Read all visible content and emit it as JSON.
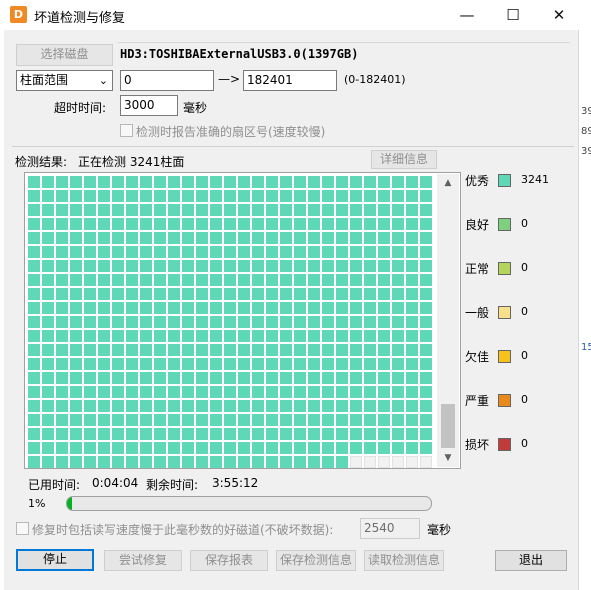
{
  "window": {
    "title": "坏道检测与修复",
    "app_icon_glyph": "D",
    "minimize_glyph": "—",
    "maximize_glyph": "☐",
    "close_glyph": "✕"
  },
  "toolbar": {
    "select_disk_label": "选择磁盘",
    "disk_name": "HD3:TOSHIBAExternalUSB3.0(1397GB)",
    "range_mode": "柱面范围",
    "range_start": "0",
    "range_arrow": "—>",
    "range_end": "182401",
    "range_hint": "(0-182401)",
    "timeout_label": "超时时间:",
    "timeout_value": "3000",
    "timeout_unit": "毫秒",
    "accurate_sector_label": "检测时报告准确的扇区号(速度较慢)"
  },
  "status": {
    "result_label": "检测结果:",
    "result_text": "正在检测 3241柱面",
    "detail_button": "详细信息",
    "elapsed_label": "已用时间:",
    "elapsed_value": "0:04:04",
    "remaining_label": "剩余时间:",
    "remaining_value": "3:55:12",
    "progress_text": "1%",
    "progress_fraction": 0.013
  },
  "grid": {
    "columns": 29,
    "rows": 21,
    "filled_cells": 603,
    "filled_color": "#5fd8b8",
    "empty_color": "#f2f2f2",
    "scroll_up_glyph": "▲",
    "scroll_down_glyph": "▼"
  },
  "legend": [
    {
      "label": "优秀",
      "color": "#5fd8b8",
      "count": "3241"
    },
    {
      "label": "良好",
      "color": "#7ed07e",
      "count": "0"
    },
    {
      "label": "正常",
      "color": "#b5d45c",
      "count": "0"
    },
    {
      "label": "一般",
      "color": "#f7e08a",
      "count": "0"
    },
    {
      "label": "欠佳",
      "color": "#f7c21b",
      "count": "0"
    },
    {
      "label": "严重",
      "color": "#e98a1a",
      "count": "0"
    },
    {
      "label": "损坏",
      "color": "#c33a3a",
      "count": "0"
    }
  ],
  "repair": {
    "slow_track_label": "修复时包括读写速度慢于此毫秒数的好磁道(不破坏数据):",
    "slow_track_value": "2540",
    "slow_track_unit": "毫秒"
  },
  "buttons": {
    "stop": "停止",
    "try_repair": "尝试修复",
    "save_report": "保存报表",
    "save_detect_info": "保存检测信息",
    "read_detect_info": "读取检测信息",
    "exit": "退出"
  },
  "background_window": {
    "numbers": [
      "39",
      "89",
      "39",
      "15"
    ]
  }
}
